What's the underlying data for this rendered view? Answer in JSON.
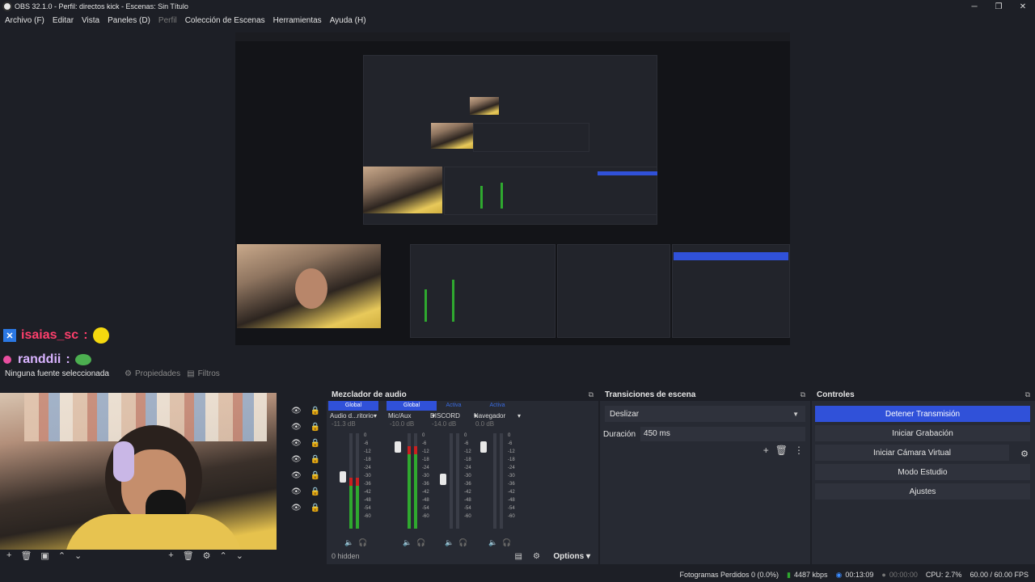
{
  "window": {
    "title": "OBS 32.1.0 - Perfil: directos kick - Escenas: Sin Título",
    "controls": [
      "─",
      "❐",
      "✕"
    ]
  },
  "menu": {
    "items": [
      "Archivo (F)",
      "Editar",
      "Vista",
      "Paneles (D)",
      "Perfil",
      "Colección de Escenas",
      "Herramientas",
      "Ayuda (H)"
    ]
  },
  "chat": {
    "user1": "isaias_sc",
    "user1_sep": ":",
    "user2": "randdii",
    "user2_sep": ":"
  },
  "source_bar": {
    "no_source": "Ninguna fuente seleccionada",
    "properties": "Propiedades",
    "filters": "Filtros"
  },
  "mixer": {
    "title": "Mezclador de audio",
    "channels": [
      {
        "status": "Global",
        "name": "Audio d...ritorio",
        "db": "-11.3 dB",
        "level": 0.45,
        "fader": 0.55
      },
      {
        "status": "Global",
        "name": "Mic/Aux",
        "db": "-10.0 dB",
        "level": 0.78,
        "fader": 0.9
      },
      {
        "status": "Activa",
        "name": "DISCORD",
        "db": "-14.0 dB",
        "level": 0.0,
        "fader": 0.52
      },
      {
        "status": "Activa",
        "name": "Navegador",
        "db": "0.0 dB",
        "level": 0.0,
        "fader": 0.9
      }
    ],
    "ticks": [
      "0",
      "-6",
      "-12",
      "-18",
      "-24",
      "-30",
      "-36",
      "-42",
      "-48",
      "-54",
      "-60"
    ],
    "hidden": "0 hidden",
    "options": "Options"
  },
  "transitions": {
    "title": "Transiciones de escena",
    "selected": "Deslizar",
    "duration_label": "Duración",
    "duration_value": "450 ms"
  },
  "controls": {
    "title": "Controles",
    "stop_stream": "Detener Transmisión",
    "start_recording": "Iniciar Grabación",
    "virtual_cam": "Iniciar Cámara Virtual",
    "studio_mode": "Modo Estudio",
    "settings": "Ajustes"
  },
  "status": {
    "dropped": "Fotogramas Perdidos 0 (0.0%)",
    "bitrate": "4487 kbps",
    "stream_time": "00:13:09",
    "rec_time": "00:00:00",
    "cpu": "CPU: 2.7%",
    "fps": "60.00 / 60.00 FPS"
  },
  "colors": {
    "accent": "#3051d9",
    "meter_green": "#2fa92f",
    "chat_user1": "#ff3f6c",
    "chat_user2": "#d9b3ff"
  }
}
